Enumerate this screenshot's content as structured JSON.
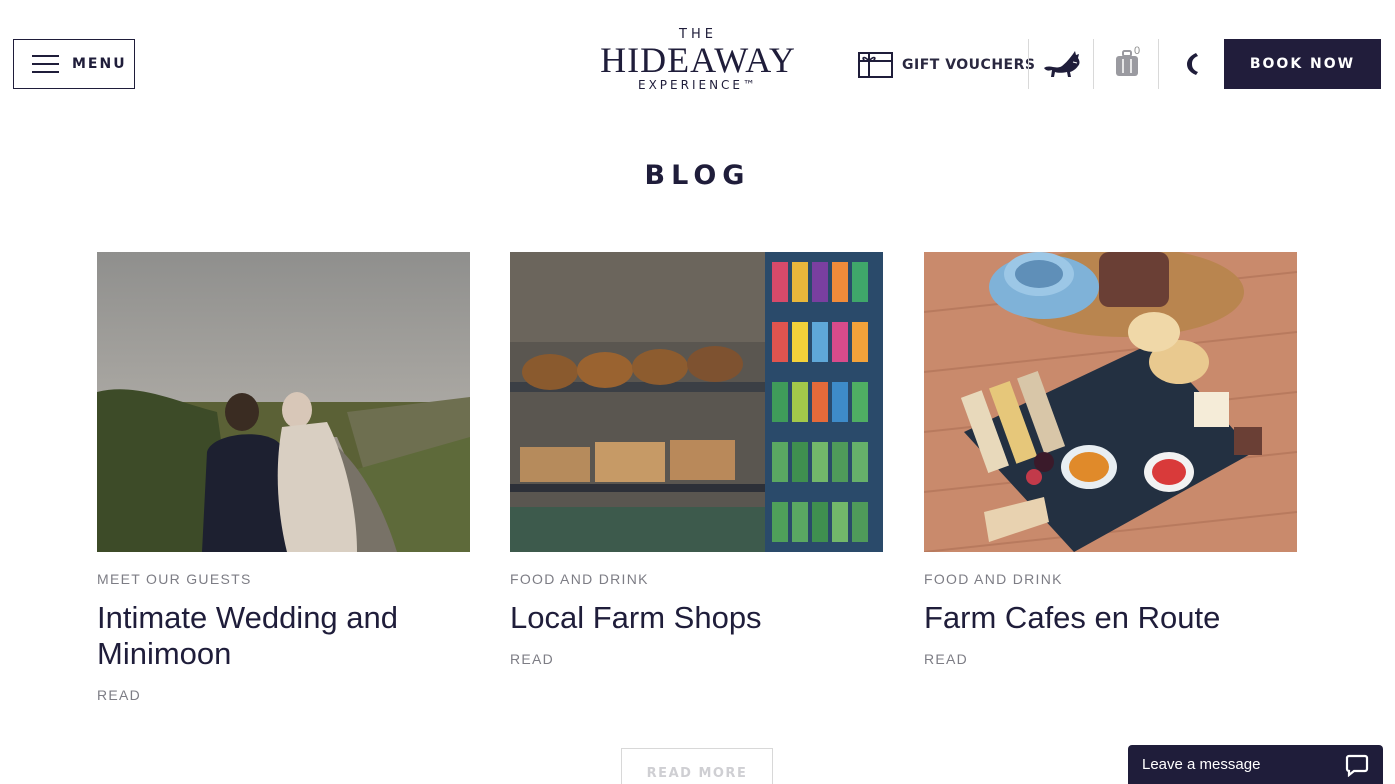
{
  "header": {
    "menu_label": "MENU",
    "logo": {
      "top": "THE",
      "main": "HIDEAWAY",
      "bottom": "EXPERIENCE™"
    },
    "gift_vouchers_label": "GIFT VOUCHERS",
    "cart_count": "0",
    "book_now_label": "BOOK NOW"
  },
  "page": {
    "title": "BLOG"
  },
  "posts": [
    {
      "category": "MEET OUR GUESTS",
      "title": "Intimate Wedding and Minimoon",
      "read_label": "READ"
    },
    {
      "category": "FOOD AND DRINK",
      "title": "Local Farm Shops",
      "read_label": "READ"
    },
    {
      "category": "FOOD AND DRINK",
      "title": "Farm Cafes en Route",
      "read_label": "READ"
    }
  ],
  "read_more_label": "READ MORE",
  "chat": {
    "label": "Leave a message"
  },
  "colors": {
    "navy": "#1f1d3a",
    "muted": "#7d7d85",
    "divider": "#d9d9d9"
  },
  "icons": [
    "menu-icon",
    "gift-card-icon",
    "fox-icon",
    "luggage-icon",
    "phone-icon",
    "chat-bubble-icon"
  ]
}
